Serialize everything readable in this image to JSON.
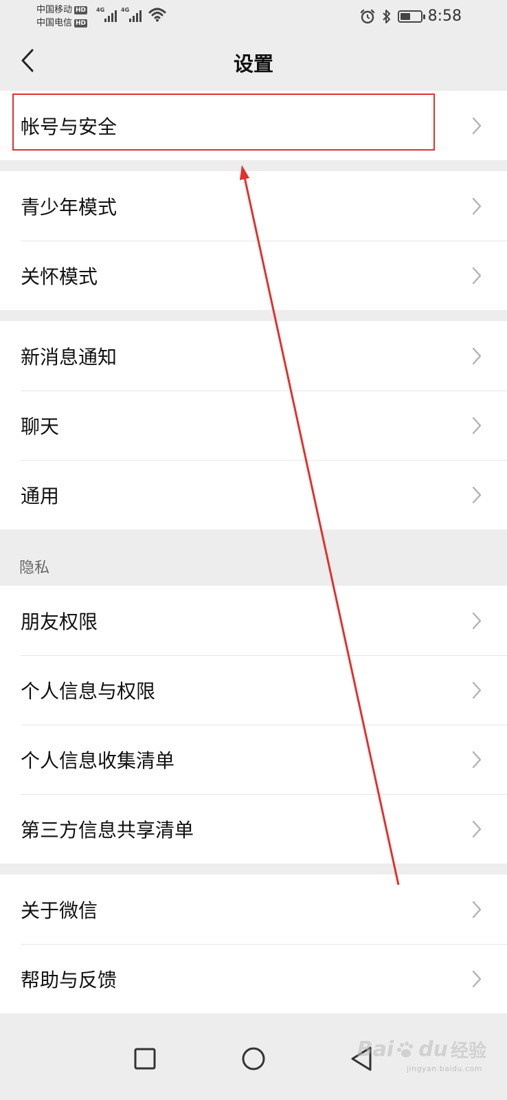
{
  "status_bar": {
    "carrier_1": "中国移动",
    "carrier_2": "中国电信",
    "hd_badge": "HD",
    "network_label": "4G",
    "time": "8:58",
    "battery_level": 0.5,
    "icons": [
      "signal-icon",
      "wifi-icon",
      "alarm-icon",
      "bluetooth-icon",
      "battery-icon"
    ]
  },
  "header": {
    "title": "设置",
    "back_icon": "chevron-left-icon"
  },
  "groups": [
    {
      "items": [
        {
          "label": "帐号与安全"
        }
      ]
    },
    {
      "items": [
        {
          "label": "青少年模式"
        },
        {
          "label": "关怀模式"
        }
      ]
    },
    {
      "items": [
        {
          "label": "新消息通知"
        },
        {
          "label": "聊天"
        },
        {
          "label": "通用"
        }
      ]
    },
    {
      "section_title": "隐私",
      "items": [
        {
          "label": "朋友权限"
        },
        {
          "label": "个人信息与权限"
        },
        {
          "label": "个人信息收集清单"
        },
        {
          "label": "第三方信息共享清单"
        }
      ]
    },
    {
      "items": [
        {
          "label": "关于微信"
        },
        {
          "label": "帮助与反馈"
        }
      ]
    }
  ],
  "bottom_nav": {
    "icons": [
      "recent-apps-icon",
      "home-icon",
      "back-triangle-icon"
    ]
  },
  "watermark": {
    "brand": "Bai",
    "brand_2": "du",
    "label": "经验",
    "url": "jingyan.baidu.com"
  },
  "colors": {
    "background": "#ededed",
    "card": "#ffffff",
    "annotation": "#e0312d",
    "text": "#111111",
    "secondary_text": "#666666"
  }
}
